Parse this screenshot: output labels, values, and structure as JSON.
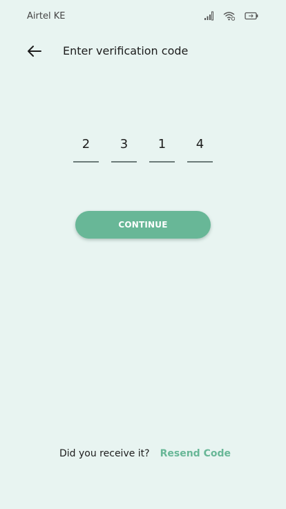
{
  "status_bar": {
    "carrier": "Airtel KE",
    "icons": [
      "signal-icon",
      "wifi-icon",
      "battery-icon"
    ]
  },
  "header": {
    "title": "Enter verification code",
    "back_icon": "arrow-left-icon"
  },
  "code": {
    "digits": [
      "2",
      "3",
      "1",
      "4"
    ]
  },
  "actions": {
    "continue_label": "CONTINUE"
  },
  "resend": {
    "prompt": "Did you receive it?",
    "link_label": "Resend Code"
  },
  "colors": {
    "background": "#e8f4f1",
    "accent": "#68b797",
    "text": "#1c1c1c",
    "underline": "#6a7a78"
  }
}
